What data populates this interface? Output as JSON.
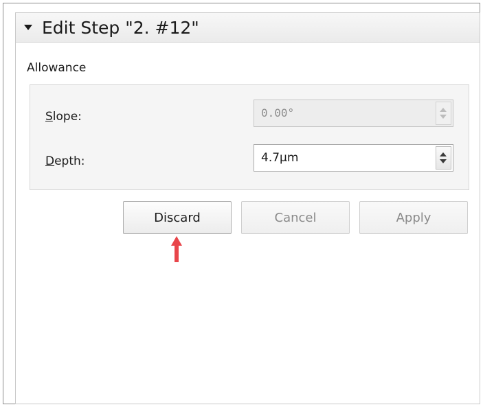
{
  "panel": {
    "title": "Edit Step \"2. #12\""
  },
  "allowance": {
    "group_label": "Allowance",
    "slope": {
      "label_mnemonic": "S",
      "label_rest": "lope:",
      "value": "0.00°",
      "enabled": false
    },
    "depth": {
      "label_mnemonic": "D",
      "label_rest": "epth:",
      "value": "4.7µm",
      "enabled": true
    }
  },
  "buttons": {
    "discard": "Discard",
    "cancel": "Cancel",
    "apply": "Apply"
  },
  "colors": {
    "annotation_arrow": "#e8454a"
  },
  "icons": {
    "collapse": "collapse-triangle-icon",
    "spin_up": "spin-up-icon",
    "spin_down": "spin-down-icon",
    "annotation": "red-arrow-icon"
  }
}
